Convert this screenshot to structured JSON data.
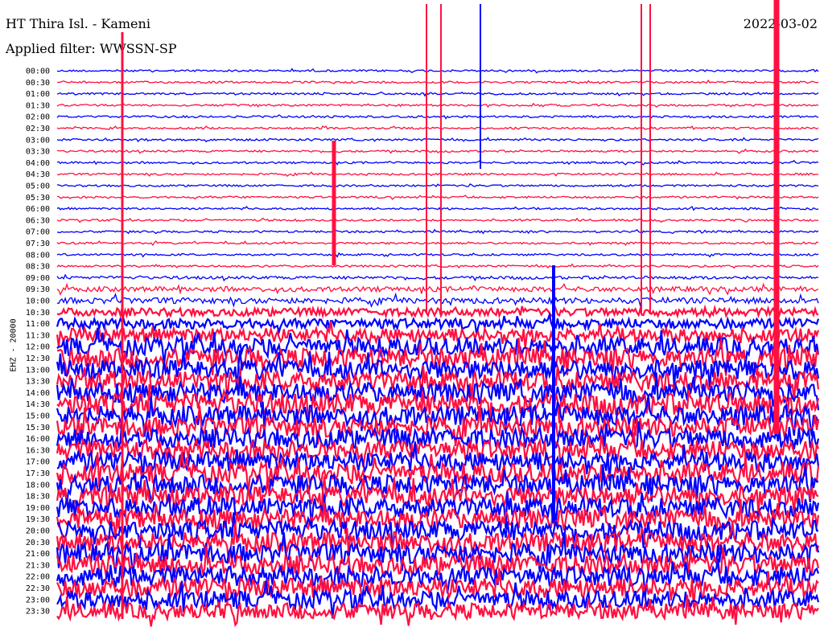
{
  "header": {
    "station": "HT Thira Isl. - Kameni",
    "filter": "Applied filter: WWSSN-SP",
    "date": "2022-03-02"
  },
  "chart_data": {
    "type": "line",
    "title": "HT Thira Isl. - Kameni",
    "subtitle": "Applied filter: WWSSN-SP",
    "ylabel": "EHZ - 20000",
    "xlabel": "",
    "tick_labels": [
      "00:00",
      "00:30",
      "01:00",
      "01:30",
      "02:00",
      "02:30",
      "03:00",
      "03:30",
      "04:00",
      "04:30",
      "05:00",
      "05:30",
      "06:00",
      "06:30",
      "07:00",
      "07:30",
      "08:00",
      "08:30",
      "09:00",
      "09:30",
      "10:00",
      "10:30",
      "11:00",
      "11:30",
      "12:00",
      "12:30",
      "13:00",
      "13:30",
      "14:00",
      "14:30",
      "15:00",
      "15:30",
      "16:00",
      "16:30",
      "17:00",
      "17:30",
      "18:00",
      "18:30",
      "19:00",
      "19:30",
      "20:00",
      "20:30",
      "21:00",
      "21:30",
      "22:00",
      "22:30",
      "23:00",
      "23:30"
    ],
    "trace_colors": [
      "#0000ff",
      "#ff1040"
    ],
    "grid": false,
    "noise_level_by_hour": [
      1,
      1,
      1,
      1,
      1,
      1,
      1,
      1,
      1,
      1,
      1,
      1,
      1,
      1,
      1,
      1,
      1,
      1,
      1.5,
      2.5,
      3,
      4,
      5,
      7,
      9,
      10,
      10,
      10,
      10,
      11,
      10,
      10,
      10,
      10,
      10,
      10,
      10,
      10,
      10,
      10,
      10,
      10,
      10,
      10,
      10,
      10,
      9,
      8
    ]
  }
}
